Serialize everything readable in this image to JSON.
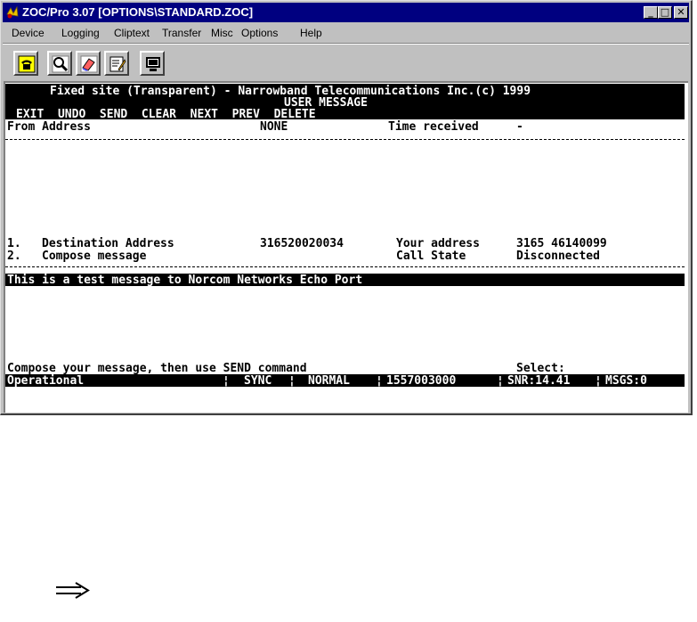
{
  "window": {
    "title": "ZOC/Pro 3.07 [OPTIONS\\STANDARD.ZOC]",
    "controls": {
      "minimize": "_",
      "maximize": "□",
      "close": "✕"
    }
  },
  "menu": [
    "Device",
    "Logging",
    "Cliptext",
    "Transfer",
    "Misc",
    "Options",
    "Help"
  ],
  "toolbar": {
    "buttons": [
      "phone-icon",
      "search-icon",
      "eraser-icon",
      "edit-icon",
      "monitor-icon"
    ]
  },
  "terminal": {
    "banner_line1": "Fixed site (Transparent) - Narrowband Telecommunications Inc.(c) 1999",
    "banner_line2": "USER MESSAGE",
    "commands": "EXIT  UNDO  SEND  CLEAR  NEXT  PREV  DELETE",
    "from_label": "From Address",
    "from_value": "NONE",
    "time_label": "Time received",
    "time_value": "-",
    "item1_num": "1.",
    "item1_label": "Destination Address",
    "item1_value": "316520020034",
    "your_address_label": "Your address",
    "your_address_value": "3165 46140099",
    "item2_num": "2.",
    "item2_label": "Compose message",
    "call_state_label": "Call State",
    "call_state_value": "Disconnected",
    "message": "This is a test message to Norcom Networks Echo Port",
    "prompt": "Compose your message, then use SEND command",
    "select_label": "Select:",
    "status": {
      "state": "Operational",
      "sync": "SYNC",
      "mode": "NORMAL",
      "id": "1557003000",
      "snr": "SNR:14.41",
      "msgs": "MSGS:0"
    }
  }
}
